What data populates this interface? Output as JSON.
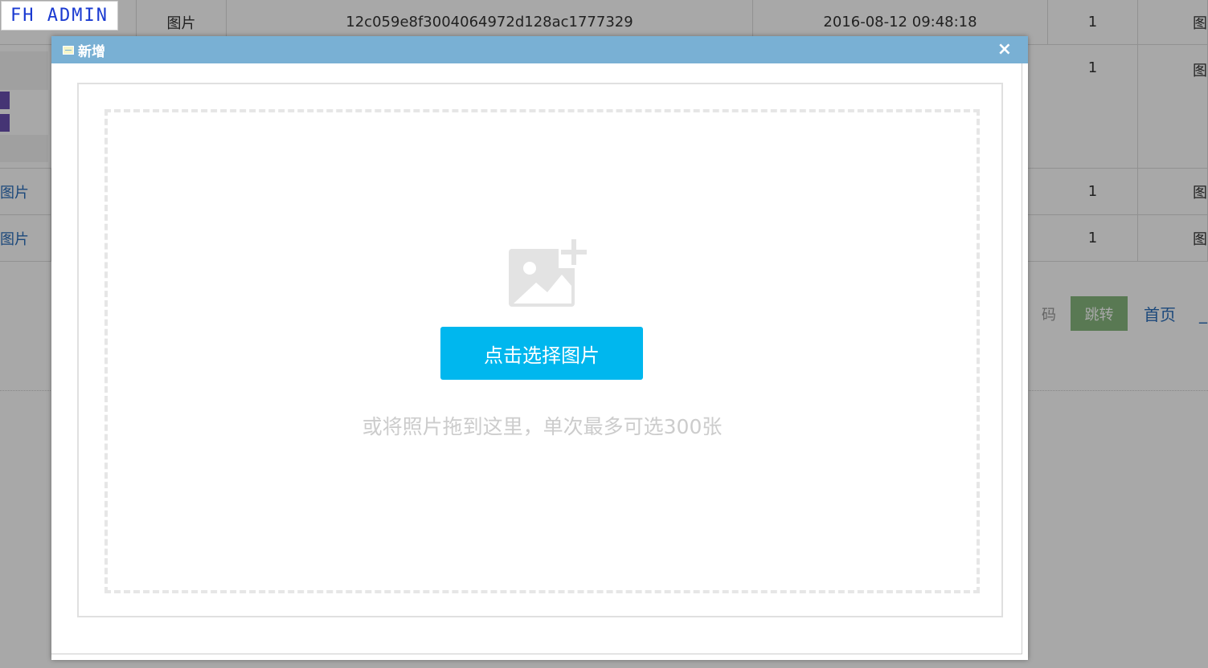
{
  "background_page": {
    "logo": "FH ADMIN",
    "rows": [
      {
        "type": "图片",
        "hash": "12c059e8f3004064972d128ac1777329",
        "time": "2016-08-12 09:48:18",
        "count": "1",
        "action": "图"
      },
      {
        "type": "",
        "hash": "",
        "time": "",
        "count": "1",
        "action": "图"
      },
      {
        "type": "图片",
        "hash": "",
        "time": "",
        "count": "1",
        "action": "图"
      },
      {
        "type": "图片",
        "hash": "",
        "time": "",
        "count": "1",
        "action": "图"
      }
    ],
    "pager": {
      "code_label": "码",
      "jump_label": "跳转",
      "home_label": "首页",
      "next_label": "_"
    }
  },
  "dialog": {
    "title": "新增",
    "close_label": "×",
    "upload": {
      "select_button": "点击选择图片",
      "hint": "或将照片拖到这里，单次最多可选300张"
    }
  },
  "colors": {
    "header": "#79b0d4",
    "primary_button": "#00b7ee",
    "jump_button": "#87b87f",
    "link": "#2a6ebb"
  }
}
